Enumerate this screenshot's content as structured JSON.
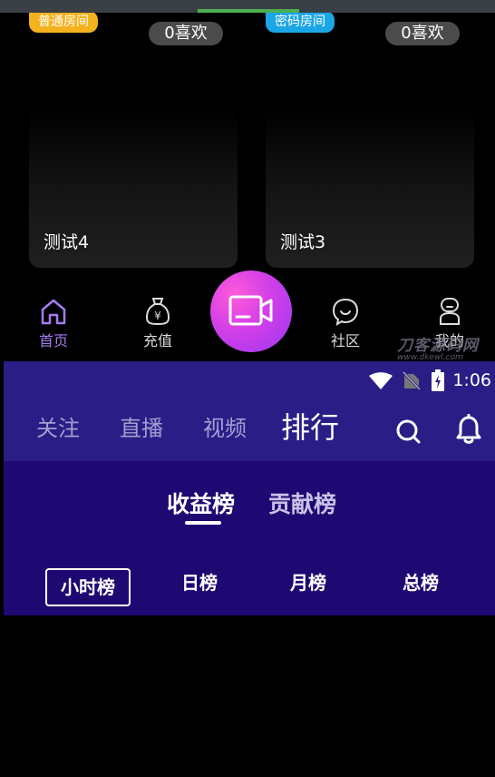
{
  "rooms": [
    {
      "badge": "普通房间",
      "likes": "0喜欢",
      "title": "测试4"
    },
    {
      "badge": "密码房间",
      "likes": "0喜欢",
      "title": "测试3"
    }
  ],
  "nav": {
    "home": "首页",
    "recharge": "充值",
    "community": "社区",
    "mine": "我的"
  },
  "watermark": {
    "main": "刀客源码网",
    "sub": "www.dkewl.com"
  },
  "status_bar": {
    "time": "1:06"
  },
  "top_tabs": [
    "关注",
    "直播",
    "视频",
    "排行"
  ],
  "board_tabs": [
    "收益榜",
    "贡献榜"
  ],
  "periods": [
    "小时榜",
    "日榜",
    "月榜",
    "总榜"
  ],
  "colors": {
    "accent_purple": "#a77bf2",
    "header_bg": "#2a1d86",
    "board_bg": "#1e0872",
    "badge_yellow": "#f4b21f",
    "badge_blue": "#1ba7e6"
  }
}
